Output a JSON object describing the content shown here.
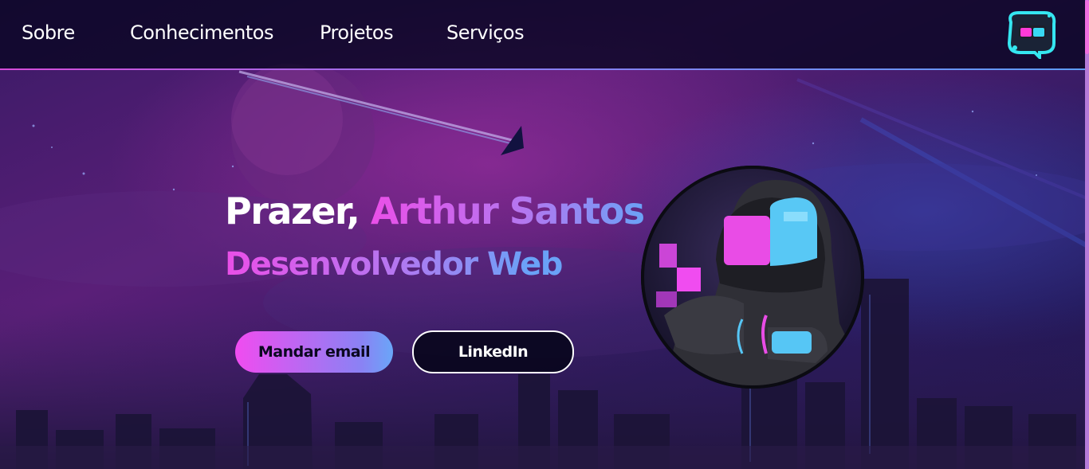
{
  "nav": {
    "items": [
      {
        "label": "Sobre"
      },
      {
        "label": "Conhecimentos"
      },
      {
        "label": "Projetos"
      },
      {
        "label": "Serviços"
      }
    ]
  },
  "hero": {
    "greeting": "Prazer,",
    "name": "Arthur Santos",
    "role": "Desenvolvedor Web"
  },
  "buttons": {
    "email": "Mandar email",
    "linkedin": "LinkedIn"
  },
  "colors": {
    "accent_pink": "#ea4fe8",
    "accent_blue": "#6aa2f7",
    "nav_bg": "#0a0623"
  },
  "icons": {
    "logo": "avatar-logo-icon"
  }
}
